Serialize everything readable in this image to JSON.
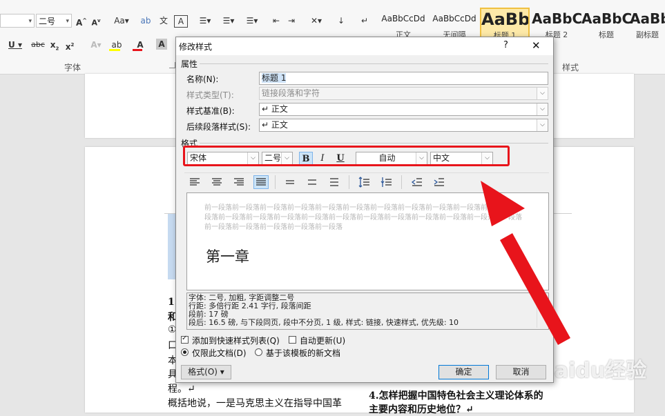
{
  "ribbon": {
    "font_size": "二号",
    "font_group_label": "字体",
    "styles_group_label": "样式",
    "styles": [
      {
        "sample": "AaBbCcDd",
        "name": "正文"
      },
      {
        "sample": "AaBbCcDd",
        "name": "无间隔"
      },
      {
        "sample": "AaBb",
        "name": "标题 1"
      },
      {
        "sample": "AaBbC",
        "name": "标题 2"
      },
      {
        "sample": "AaBbC",
        "name": "标题"
      },
      {
        "sample": "AaBb",
        "name": "副标题"
      }
    ]
  },
  "document": {
    "left_lines": [
      "1.",
      "和",
      "①",
      "口",
      "本",
      "具",
      "程。↵",
      "概括地说，一是马克思主义在指导中国革"
    ],
    "right_heading_1": "4.怎样把握中国特色社会主义理论体系的",
    "right_heading_2": "主要内容和历史地位？↵"
  },
  "dialog": {
    "title": "修改样式",
    "help": "?",
    "close": "✕",
    "section_properties": "属性",
    "name_label": "名称(N):",
    "name_value": "标题 1",
    "style_type_label": "样式类型(T):",
    "style_type_value": "链接段落和字符",
    "based_on_label": "样式基准(B):",
    "based_on_value": "↵ 正文",
    "next_style_label": "后续段落样式(S):",
    "next_style_value": "↵ 正文",
    "section_format": "格式",
    "font_name": "宋体",
    "font_size": "二号",
    "bold": "B",
    "italic": "I",
    "underline": "U",
    "color": "自动",
    "script": "中文",
    "preview_gray": [
      "前一段落前一段落前一段落前一段落前一段落前一段落前一段落前一段落前一段落前一段落前一段落前一",
      "段落前一段落前一段落前一段落前一段落前一段落前一段落前一段落前一段落前一段落前一段落前一段落",
      "前一段落前一段落前一段落前一段落前一段落"
    ],
    "preview_heading": "第一章",
    "description": [
      "字体: 二号, 加粗, 字距调整二号",
      "    行距: 多倍行距 2.41 字行, 段落间距",
      "    段前: 17 磅",
      "    段后: 16.5 磅, 与下段同页, 段中不分页, 1 级, 样式: 链接, 快速样式, 优先级: 10"
    ],
    "add_to_quick": "添加到快速样式列表(Q)",
    "auto_update": "自动更新(U)",
    "only_this_doc": "仅限此文档(D)",
    "new_docs_template": "基于该模板的新文档",
    "format_button": "格式(O) ▾",
    "ok": "确定",
    "cancel": "取消"
  },
  "watermark": "Baidu经验",
  "colors": {
    "highlight_red": "#e8141b",
    "selected_blue": "#cfe3f7",
    "accent": "#2b579a"
  }
}
